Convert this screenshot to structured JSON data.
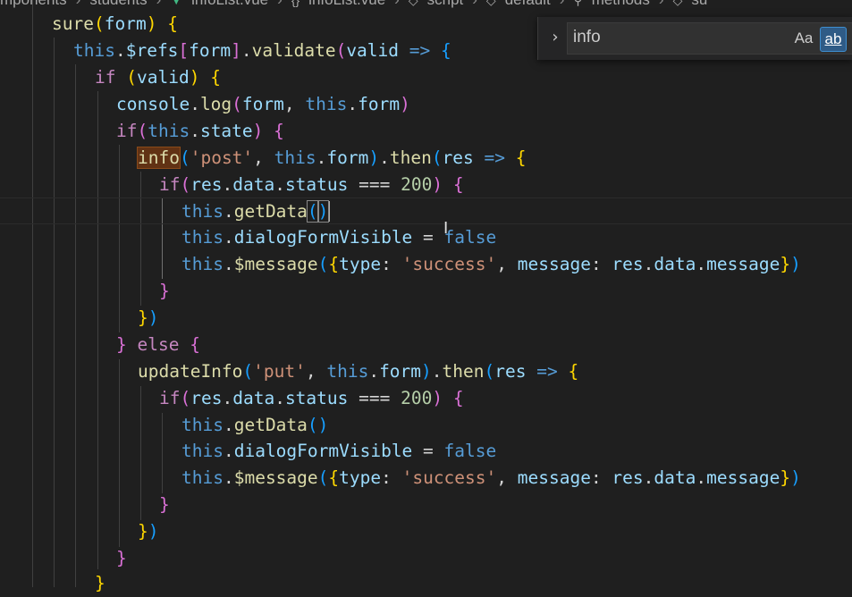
{
  "breadcrumb": {
    "items": [
      "mponents",
      "students",
      "infoList.vue",
      "infoList.vue",
      "script",
      "default",
      "methods",
      "su"
    ],
    "vue_icon": "vue-file-icon",
    "symbol_icons": [
      "braces-icon",
      "cube-icon",
      "cube-icon",
      "wrench-icon",
      "cube-icon"
    ]
  },
  "find_widget": {
    "query": "info",
    "toggle_replace_icon": "chevron-right-icon",
    "match_case_label": "Aa",
    "whole_word_label": "ab",
    "whole_word_active": true
  },
  "code": {
    "lines": [
      "sure(form) {",
      "this.$refs[form].validate(valid => {",
      "if (valid) {",
      "console.log(form, this.form)",
      "if(this.state) {",
      "info('post', this.form).then(res => {",
      "if(res.data.status === 200) {",
      "this.getData()",
      "this.dialogFormVisible = false",
      "this.$message({type: 'success', message: res.data.message})",
      "}",
      "})",
      "} else {",
      "updateInfo('put', this.form).then(res => {",
      "if(res.data.status === 200) {",
      "this.getData()",
      "this.dialogFormVisible = false",
      "this.$message({type: 'success', message: res.data.message})",
      "}",
      "})",
      "}",
      "}"
    ],
    "highlighted_match": "info"
  },
  "colors": {
    "editor_bg": "#1f1f1f",
    "keyword": "#c586c0",
    "this": "#569cd6",
    "function": "#dcdcaa",
    "variable": "#9cdcfe",
    "string": "#ce9178",
    "number": "#b5cea8",
    "find_match_bg": "#613214",
    "active_toggle": "#2f5b86"
  },
  "cursor_icon": "text-cursor-icon"
}
